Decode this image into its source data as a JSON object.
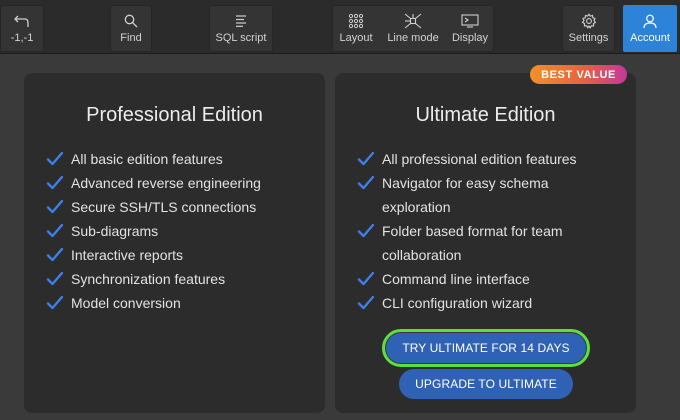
{
  "toolbar": {
    "coords_label": "-1,-1",
    "find_label": "Find",
    "sql_label": "SQL script",
    "layout_label": "Layout",
    "line_mode_label": "Line mode",
    "display_label": "Display",
    "settings_label": "Settings",
    "account_label": "Account"
  },
  "badge": "BEST VALUE",
  "professional": {
    "title": "Professional Edition",
    "features": [
      "All basic edition features",
      "Advanced reverse engineering",
      "Secure SSH/TLS connections",
      "Sub-diagrams",
      "Interactive reports",
      "Synchronization features",
      "Model conversion"
    ]
  },
  "ultimate": {
    "title": "Ultimate Edition",
    "features": [
      {
        "line1": "All professional edition features"
      },
      {
        "line1": "Navigator for easy schema",
        "line2": "exploration"
      },
      {
        "line1": "Folder based format for team",
        "line2": "collaboration"
      },
      {
        "line1": "Command line interface"
      },
      {
        "line1": "CLI configuration wizard"
      }
    ],
    "trial_button": "TRY ULTIMATE FOR 14 DAYS",
    "upgrade_button": "UPGRADE TO ULTIMATE"
  },
  "colors": {
    "accent": "#2d83d8",
    "check": "#3f7fe8",
    "button": "#2f62b4",
    "focus_ring": "#5de03b"
  },
  "icons": {
    "undo": "undo-arrow-icon",
    "find": "search-icon",
    "sql": "text-lines-icon",
    "layout": "grid-icon",
    "line_mode": "network-lines-icon",
    "display": "monitor-icon",
    "settings": "gear-icon",
    "account": "user-icon"
  }
}
